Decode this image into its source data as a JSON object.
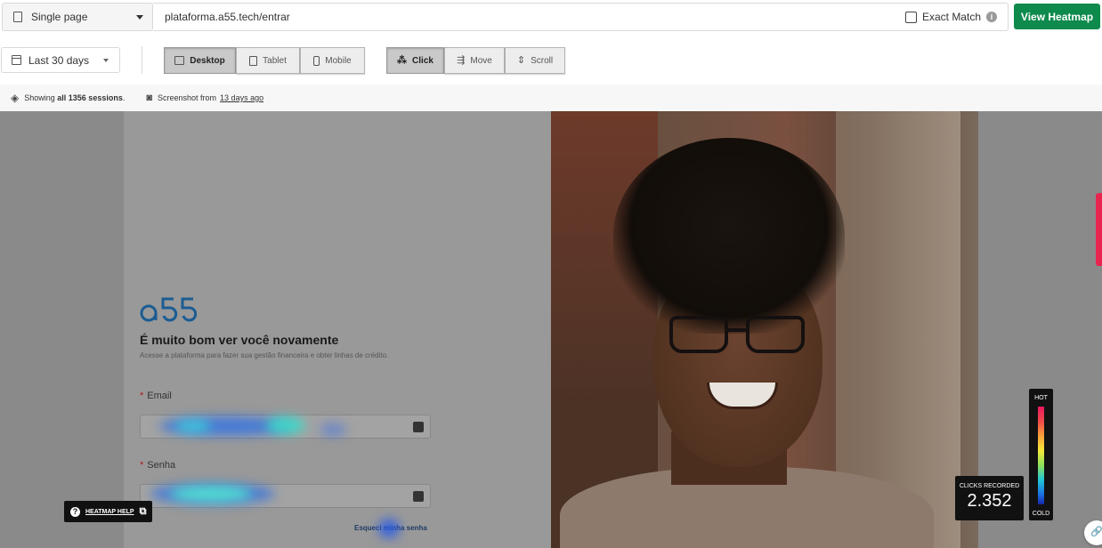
{
  "top_bar": {
    "page_type": "Single page",
    "url": "plataforma.a55.tech/entrar",
    "exact_match_label": "Exact Match",
    "view_heatmap_label": "View Heatmap"
  },
  "filters": {
    "date_range": "Last 30 days",
    "devices": [
      {
        "label": "Desktop",
        "active": true,
        "icon": "desktop-icon"
      },
      {
        "label": "Tablet",
        "active": false,
        "icon": "tablet-icon"
      },
      {
        "label": "Mobile",
        "active": false,
        "icon": "mobile-icon"
      }
    ],
    "modes": [
      {
        "label": "Click",
        "active": true,
        "icon": "click-icon"
      },
      {
        "label": "Move",
        "active": false,
        "icon": "move-icon"
      },
      {
        "label": "Scroll",
        "active": false,
        "icon": "scroll-icon"
      }
    ]
  },
  "info": {
    "showing_prefix": "Showing",
    "sessions_text": "all 1356 sessions",
    "showing_suffix": ".",
    "screenshot_prefix": "Screenshot from",
    "screenshot_age": "13 days ago"
  },
  "page": {
    "welcome": "É muito bom ver você novamente",
    "subtitle": "Acesse a plataforma para fazer sua gestão financeira e obter linhas de crédito.",
    "email_label": "Email",
    "password_label": "Senha",
    "required_mark": "*",
    "forgot_label": "Esqueci minha senha"
  },
  "overlay": {
    "help_label": "HEATMAP HELP",
    "legend_hot": "HOT",
    "legend_cold": "COLD",
    "clicks_label": "CLICKS RECORDED",
    "clicks_value": "2.352"
  },
  "colors": {
    "primary_button": "#0e8a4c",
    "scroll_marker": "#e8254f"
  }
}
